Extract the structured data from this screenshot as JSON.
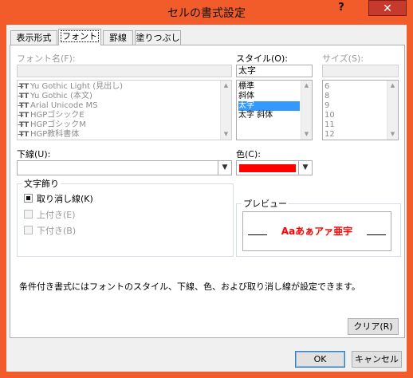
{
  "window": {
    "title": "セルの書式設定",
    "help": "?",
    "close": "✕"
  },
  "tabs": [
    {
      "label": "表示形式"
    },
    {
      "label": "フォント"
    },
    {
      "label": "罫線"
    },
    {
      "label": "塗りつぶし"
    }
  ],
  "font_name": {
    "label": "フォント名(F):",
    "value": "",
    "items": [
      "Yu Gothic Light (見出し)",
      "Yu Gothic (本文)",
      "Arial Unicode MS",
      "HGPゴシックE",
      "HGPゴシックM",
      "HGP教科書体"
    ]
  },
  "style": {
    "label": "スタイル(O):",
    "value": "太字",
    "items": [
      "標準",
      "斜体",
      "太字",
      "太字 斜体"
    ],
    "selected_index": 2
  },
  "size": {
    "label": "サイズ(S):",
    "value": "",
    "items": [
      "6",
      "8",
      "9",
      "10",
      "11",
      "12"
    ]
  },
  "underline": {
    "label": "下線(U):",
    "value": ""
  },
  "color": {
    "label": "色(C):",
    "value_color": "#ff0000"
  },
  "effects": {
    "legend": "文字飾り",
    "strikethrough": {
      "label": "取り消し線(K)",
      "state": "indeterminate"
    },
    "superscript": {
      "label": "上付き(E)"
    },
    "subscript": {
      "label": "下付き(B)"
    }
  },
  "preview": {
    "legend": "プレビュー",
    "sample": "Aaあぁアァ亜宇",
    "color": "#ff0000"
  },
  "info_text": "条件付き書式にはフォントのスタイル、下線、色、および取り消し線が設定できます。",
  "buttons": {
    "clear": "クリア(R)",
    "ok": "OK",
    "cancel": "キャンセル"
  },
  "colors": {
    "title_bar": "#f25b2a",
    "selection": "#3399ff",
    "close": "#c7392d"
  }
}
